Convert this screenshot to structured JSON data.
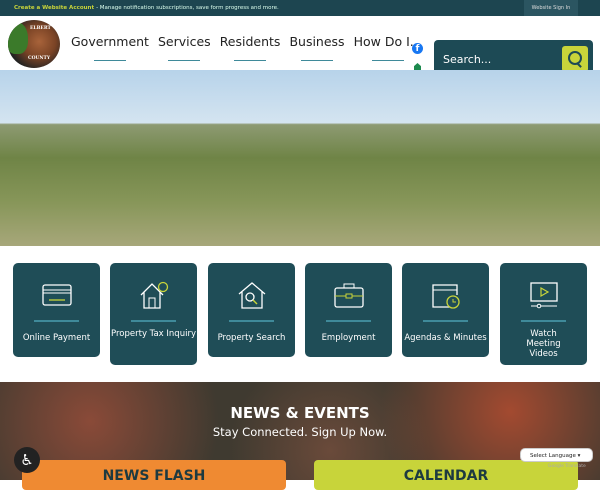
{
  "topbar": {
    "create_account": "Create a Website Account",
    "message": " - Manage notification subscriptions, save form progress and more.",
    "sign_in": "Website Sign In"
  },
  "logo": {
    "text_top": "ELBERT",
    "text_bottom": "COUNTY"
  },
  "nav": [
    "Government",
    "Services",
    "Residents",
    "Business",
    "How Do I..."
  ],
  "search": {
    "placeholder": "Search..."
  },
  "tiles": [
    {
      "label": "Online Payment",
      "icon": "credit-card-icon"
    },
    {
      "label": "Property Tax Inquiry",
      "icon": "house-dollar-icon"
    },
    {
      "label": "Property Search",
      "icon": "house-search-icon"
    },
    {
      "label": "Employment",
      "icon": "briefcase-icon"
    },
    {
      "label": "Agendas & Minutes",
      "icon": "calendar-clock-icon"
    },
    {
      "label": "Watch Meeting Videos",
      "icon": "video-player-icon"
    }
  ],
  "news": {
    "title": "NEWS & EVENTS",
    "subtitle": "Stay Connected. Sign Up Now.",
    "news_flash": "NEWS FLASH",
    "calendar": "CALENDAR"
  },
  "translate": {
    "select": "Select Language",
    "powered": "Google Translate"
  },
  "colors": {
    "teal": "#1f4d57",
    "lime": "#c8d43a",
    "orange": "#ef8a32"
  }
}
